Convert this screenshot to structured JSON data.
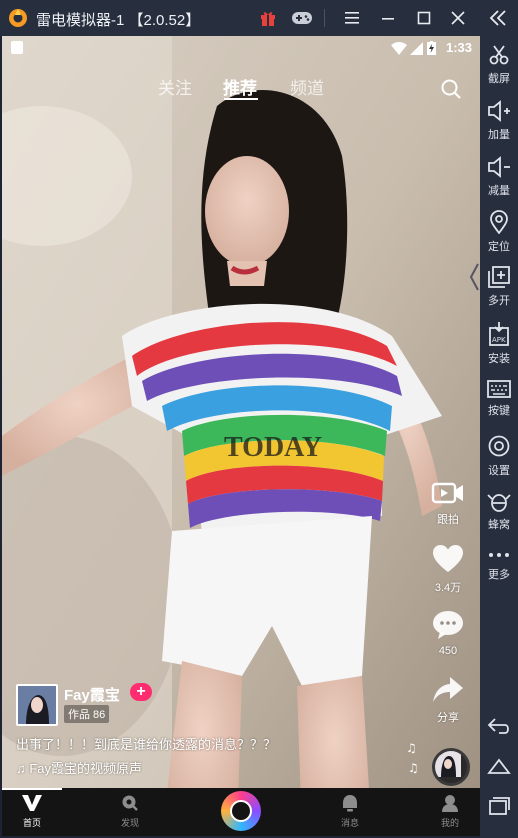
{
  "window": {
    "title": "雷电模拟器-1 【2.0.52】",
    "icons": [
      "leidian-logo-icon",
      "gift-icon",
      "gamepad-icon",
      "menu-icon",
      "minimize-icon",
      "maximize-icon",
      "close-icon",
      "collapse-arrows-icon"
    ]
  },
  "statusbar": {
    "time": "1:33"
  },
  "tabs": [
    {
      "label": "关注",
      "active": false
    },
    {
      "label": "推荐",
      "active": true
    },
    {
      "label": "频道",
      "active": false
    }
  ],
  "actions": {
    "shoot_label": "跟拍",
    "like_count": "3.4万",
    "comment_count": "450",
    "share_label": "分享"
  },
  "author": {
    "name": "Fay霞宝",
    "follow": "+",
    "works": "作品 86"
  },
  "caption": "出事了！！！到底是谁给你透露的消息？？？",
  "music": "♫ Fay霞宝的视频原声",
  "bottomnav": {
    "items": [
      {
        "label": "首页",
        "icon": "v-logo-icon",
        "active": true
      },
      {
        "label": "发现",
        "icon": "discover-icon",
        "active": false
      },
      {
        "label": "消息",
        "icon": "message-icon",
        "active": false
      },
      {
        "label": "我的",
        "icon": "profile-icon",
        "active": false
      }
    ]
  },
  "sidebar": {
    "items": [
      {
        "label": "截屏",
        "icon": "scissors-icon"
      },
      {
        "label": "加量",
        "icon": "volume-up-icon"
      },
      {
        "label": "减量",
        "icon": "volume-down-icon"
      },
      {
        "label": "定位",
        "icon": "location-icon"
      },
      {
        "label": "多开",
        "icon": "multi-instance-icon"
      },
      {
        "label": "安装",
        "icon": "apk-install-icon"
      },
      {
        "label": "按键",
        "icon": "keyboard-icon"
      },
      {
        "label": "设置",
        "icon": "settings-icon"
      },
      {
        "label": "蜂窝",
        "icon": "hive-icon"
      },
      {
        "label": "更多",
        "icon": "more-icon"
      }
    ],
    "nav": [
      "back-icon",
      "home-icon",
      "recents-icon"
    ]
  },
  "colors": {
    "accent": "#ff2d6f",
    "titlebar": "#272e3e",
    "gift": "#e8413c"
  }
}
